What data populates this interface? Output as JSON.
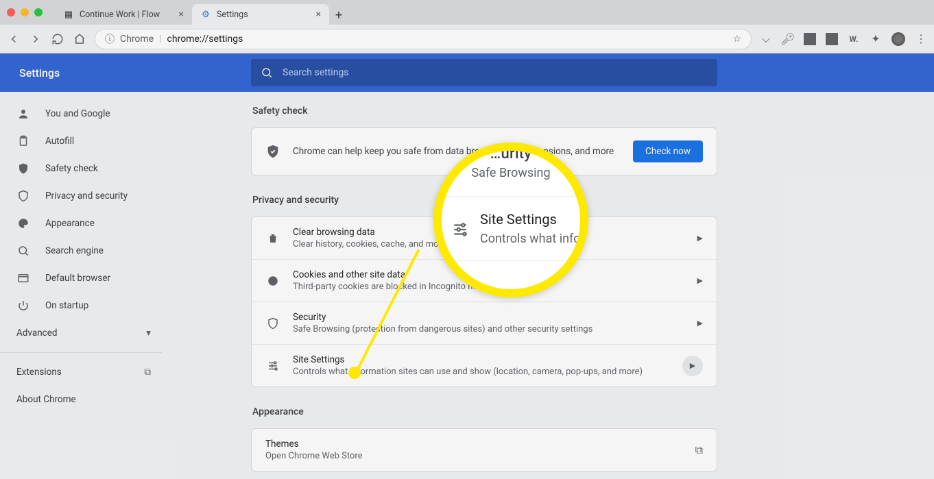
{
  "window": {
    "tabs": [
      {
        "title": "Continue Work | Flow",
        "active": false
      },
      {
        "title": "Settings",
        "active": true
      }
    ]
  },
  "omnibox": {
    "scheme_label": "Chrome",
    "url": "chrome://settings"
  },
  "header": {
    "title": "Settings",
    "search_placeholder": "Search settings"
  },
  "sidebar": {
    "items": [
      {
        "icon": "person-icon",
        "label": "You and Google"
      },
      {
        "icon": "clipboard-icon",
        "label": "Autofill"
      },
      {
        "icon": "shield-check-icon",
        "label": "Safety check"
      },
      {
        "icon": "shield-icon",
        "label": "Privacy and security"
      },
      {
        "icon": "palette-icon",
        "label": "Appearance"
      },
      {
        "icon": "search-icon",
        "label": "Search engine"
      },
      {
        "icon": "browser-icon",
        "label": "Default browser"
      },
      {
        "icon": "power-icon",
        "label": "On startup"
      }
    ],
    "advanced_label": "Advanced",
    "bottom": [
      {
        "label": "Extensions",
        "external": true
      },
      {
        "label": "About Chrome",
        "external": false
      }
    ]
  },
  "sections": {
    "safety": {
      "title": "Safety check",
      "message": "Chrome can help keep you safe from data breaches, bad extensions, and more",
      "button": "Check now"
    },
    "privacy": {
      "title": "Privacy and security",
      "rows": [
        {
          "icon": "trash-icon",
          "title": "Clear browsing data",
          "sub": "Clear history, cookies, cache, and more"
        },
        {
          "icon": "cookie-icon",
          "title": "Cookies and other site data",
          "sub": "Third-party cookies are blocked in Incognito mode"
        },
        {
          "icon": "shield-icon",
          "title": "Security",
          "sub": "Safe Browsing (protection from dangerous sites) and other security settings"
        },
        {
          "icon": "tune-icon",
          "title": "Site Settings",
          "sub": "Controls what information sites can use and show (location, camera, pop-ups, and more)"
        }
      ]
    },
    "appearance": {
      "title": "Appearance",
      "rows": [
        {
          "title": "Themes",
          "sub": "Open Chrome Web Store"
        }
      ]
    }
  },
  "magnifier": {
    "top_peek": "…urity",
    "safe": "Safe Browsing",
    "t1": "Site Settings",
    "t2": "Controls what info"
  }
}
